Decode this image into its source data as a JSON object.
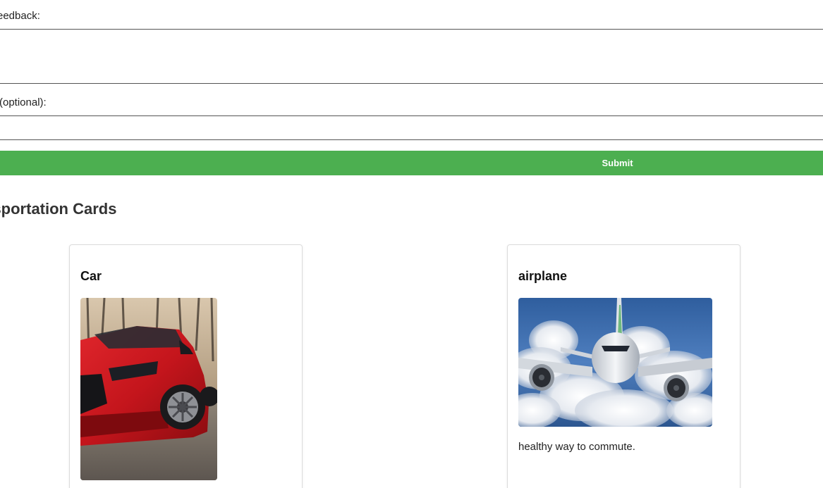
{
  "form": {
    "feedback_label": "eedback:",
    "feedback_value": "",
    "optional_label": "(optional):",
    "optional_value": "",
    "submit_label": "Submit"
  },
  "section": {
    "heading": "nsportation Cards"
  },
  "cards": [
    {
      "title": "Car",
      "image": "red-car-photo",
      "text": ""
    },
    {
      "title": "airplane",
      "image": "airplane-in-clouds-photo",
      "text": "healthy way to commute."
    }
  ],
  "colors": {
    "submit_bg": "#4caf50",
    "submit_text": "#ffffff",
    "border": "#dcdcdc"
  }
}
